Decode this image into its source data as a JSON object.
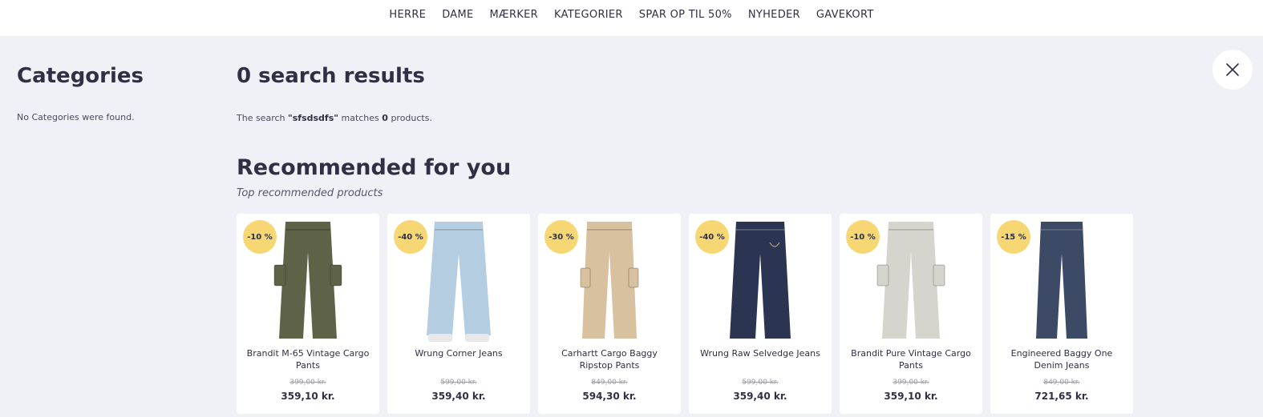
{
  "nav": {
    "items": [
      "HERRE",
      "DAME",
      "MÆRKER",
      "KATEGORIER",
      "SPAR OP TIL 50%",
      "NYHEDER",
      "GAVEKORT"
    ]
  },
  "sidebar": {
    "title": "Categories",
    "empty_text": "No Categories were found."
  },
  "results": {
    "title": "0 search results",
    "text_prefix": "The search",
    "query": "\"sfsdsdfs\"",
    "text_middle": "matches",
    "count": "0",
    "text_suffix": "products."
  },
  "recommended": {
    "title": "Recommended for you",
    "subtitle": "Top recommended products"
  },
  "products": [
    {
      "name": "Brandit M-65 Vintage Cargo Pants",
      "badge": "-10 %",
      "old_price": "399,00 kr.",
      "price": "359,10 kr.",
      "color": "#5e6347",
      "icon": "cargo-pants-icon"
    },
    {
      "name": "Wrung Corner Jeans",
      "badge": "-40 %",
      "old_price": "599,00 kr.",
      "price": "359,40 kr.",
      "color": "#b5cde0",
      "icon": "jeans-icon"
    },
    {
      "name": "Carhartt Cargo Baggy Ripstop Pants",
      "badge": "-30 %",
      "old_price": "849,00 kr.",
      "price": "594,30 kr.",
      "color": "#d8c19f",
      "icon": "cargo-pants-icon"
    },
    {
      "name": "Wrung Raw Selvedge Jeans",
      "badge": "-40 %",
      "old_price": "599,00 kr.",
      "price": "359,40 kr.",
      "color": "#2b3552",
      "icon": "jeans-icon"
    },
    {
      "name": "Brandit Pure Vintage Cargo Pants",
      "badge": "-10 %",
      "old_price": "399,00 kr.",
      "price": "359,10 kr.",
      "color": "#d6d5cd",
      "icon": "cargo-pants-icon"
    },
    {
      "name": "Engineered Baggy One Denim Jeans",
      "badge": "-15 %",
      "old_price": "849,00 kr.",
      "price": "721,65 kr.",
      "color": "#3c4a66",
      "icon": "jeans-icon"
    }
  ]
}
